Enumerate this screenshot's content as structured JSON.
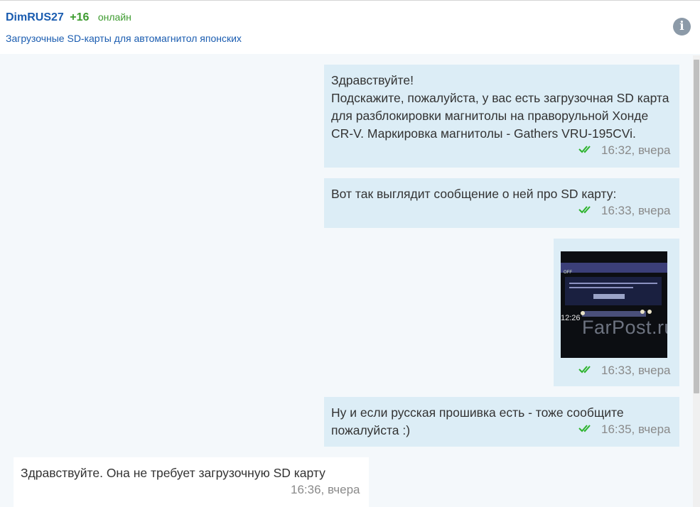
{
  "header": {
    "username": "DimRUS27",
    "rating": "+16",
    "status": "онлайн",
    "subject": "Загрузочные SD-карты для автомагнитол японских",
    "info_icon": "info-icon"
  },
  "messages": [
    {
      "direction": "outgoing",
      "lines": [
        "Здравствуйте!",
        "Подскажите, пожалуйста, у вас есть загрузочная SD карта",
        "для разблокировки магнитолы на праворульной Хонде",
        "CR-V. Маркировка магнитолы - Gathers VRU-195CVi."
      ],
      "time": "16:32, вчера",
      "read_icon": "double-check-icon"
    },
    {
      "direction": "outgoing",
      "lines": [
        "Вот так выглядит сообщение о ней про SD карту:"
      ],
      "time": "16:33, вчера",
      "read_icon": "double-check-icon"
    },
    {
      "direction": "outgoing",
      "attachment": "photo",
      "photo": {
        "screen_title": "OFF",
        "screen_text": "ドライブレコーダーのSDカードが挿入されていません。",
        "watermark": "FarPost.ru",
        "clock": "12:26"
      },
      "time": "16:33, вчера",
      "read_icon": "double-check-icon"
    },
    {
      "direction": "outgoing",
      "lines": [
        "Ну и если русская прошивка есть - тоже сообщите",
        "пожалуйста :)"
      ],
      "time": "16:35, вчера",
      "read_icon": "double-check-icon"
    },
    {
      "direction": "incoming",
      "lines": [
        "Здравствуйте. Она не требует загрузочную SD карту"
      ],
      "time": "16:36, вчера"
    }
  ],
  "colors": {
    "username": "#1a5cb0",
    "online": "#3d9b2f",
    "outgoing_bubble": "#dcedf6",
    "incoming_bubble": "#ffffff",
    "chat_background": "#f4f8fb",
    "read_check": "#2db32d"
  }
}
